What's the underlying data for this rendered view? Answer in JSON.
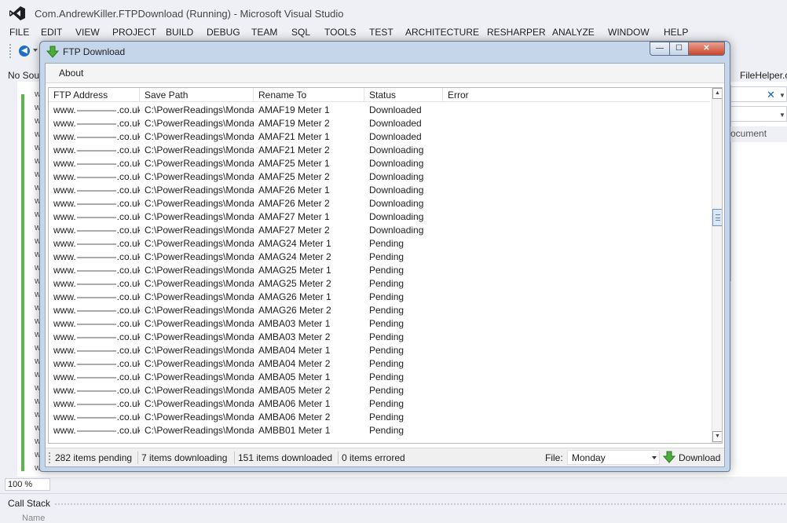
{
  "vs": {
    "title": "Com.AndrewKiller.FTPDownload (Running) - Microsoft Visual Studio",
    "menu": [
      "FILE",
      "EDIT",
      "VIEW",
      "PROJECT",
      "BUILD",
      "DEBUG",
      "TEAM",
      "SQL",
      "TOOLS",
      "TEST",
      "ARCHITECTURE",
      "RESHARPER",
      "ANALYZE",
      "WINDOW",
      "HELP"
    ],
    "no_source_tab": "No Sou",
    "filehelper_tab": "FileHelper.c",
    "right_panel_header": "ocument",
    "zoom": "100 %",
    "call_stack": "Call Stack",
    "call_stack_column": "Name",
    "accent": "#57b94a"
  },
  "ftp": {
    "title": "FTP Download",
    "controls": {
      "minimize": "—",
      "maximize": "☐",
      "close": "✕"
    },
    "menu_about": "About",
    "columns": [
      "FTP Address",
      "Save Path",
      "Rename To",
      "Status",
      "Error"
    ],
    "rows": [
      [
        "www.",
        "co.uk",
        "C:\\PowerReadings\\Monday",
        "AMAF19 Meter 1",
        "Downloaded",
        ""
      ],
      [
        "www.",
        "co.uk",
        "C:\\PowerReadings\\Monday",
        "AMAF19 Meter 2",
        "Downloaded",
        ""
      ],
      [
        "www.",
        "co.uk",
        "C:\\PowerReadings\\Monday",
        "AMAF21 Meter 1",
        "Downloaded",
        ""
      ],
      [
        "www.",
        "co.uk",
        "C:\\PowerReadings\\Monday",
        "AMAF21 Meter 2",
        "Downloading",
        ""
      ],
      [
        "www.",
        "co.uk",
        "C:\\PowerReadings\\Monday",
        "AMAF25 Meter 1",
        "Downloading",
        ""
      ],
      [
        "www.",
        "co.uk",
        "C:\\PowerReadings\\Monday",
        "AMAF25 Meter 2",
        "Downloading",
        ""
      ],
      [
        "www.",
        "co.uk",
        "C:\\PowerReadings\\Monday",
        "AMAF26 Meter 1",
        "Downloading",
        ""
      ],
      [
        "www.",
        "co.uk",
        "C:\\PowerReadings\\Monday",
        "AMAF26 Meter 2",
        "Downloading",
        ""
      ],
      [
        "www.",
        "co.uk",
        "C:\\PowerReadings\\Monday",
        "AMAF27 Meter 1",
        "Downloading",
        ""
      ],
      [
        "www.",
        "co.uk",
        "C:\\PowerReadings\\Monday",
        "AMAF27 Meter 2",
        "Downloading",
        ""
      ],
      [
        "www.",
        "co.uk",
        "C:\\PowerReadings\\Monday",
        "AMAG24 Meter 1",
        "Pending",
        ""
      ],
      [
        "www.",
        "co.uk",
        "C:\\PowerReadings\\Monday",
        "AMAG24 Meter 2",
        "Pending",
        ""
      ],
      [
        "www.",
        "co.uk",
        "C:\\PowerReadings\\Monday",
        "AMAG25 Meter 1",
        "Pending",
        ""
      ],
      [
        "www.",
        "co.uk",
        "C:\\PowerReadings\\Monday",
        "AMAG25 Meter 2",
        "Pending",
        ""
      ],
      [
        "www.",
        "co.uk",
        "C:\\PowerReadings\\Monday",
        "AMAG26 Meter 1",
        "Pending",
        ""
      ],
      [
        "www.",
        "co.uk",
        "C:\\PowerReadings\\Monday",
        "AMAG26 Meter 2",
        "Pending",
        ""
      ],
      [
        "www.",
        "co.uk",
        "C:\\PowerReadings\\Monday",
        "AMBA03 Meter 1",
        "Pending",
        ""
      ],
      [
        "www.",
        "co.uk",
        "C:\\PowerReadings\\Monday",
        "AMBA03 Meter 2",
        "Pending",
        ""
      ],
      [
        "www.",
        "co.uk",
        "C:\\PowerReadings\\Monday",
        "AMBA04 Meter 1",
        "Pending",
        ""
      ],
      [
        "www.",
        "co.uk",
        "C:\\PowerReadings\\Monday",
        "AMBA04 Meter 2",
        "Pending",
        ""
      ],
      [
        "www.",
        "co.uk",
        "C:\\PowerReadings\\Monday",
        "AMBA05 Meter 1",
        "Pending",
        ""
      ],
      [
        "www.",
        "co.uk",
        "C:\\PowerReadings\\Monday",
        "AMBA05 Meter 2",
        "Pending",
        ""
      ],
      [
        "www.",
        "co.uk",
        "C:\\PowerReadings\\Monday",
        "AMBA06 Meter 1",
        "Pending",
        ""
      ],
      [
        "www.",
        "co.uk",
        "C:\\PowerReadings\\Monday",
        "AMBA06 Meter 2",
        "Pending",
        ""
      ],
      [
        "www.",
        "co.uk",
        "C:\\PowerReadings\\Monday",
        "AMBB01 Meter 1",
        "Pending",
        ""
      ]
    ],
    "status": {
      "pending": "282 items pending",
      "downloading": "7 items downloading",
      "downloaded": "151 items downloaded",
      "errored": "0 items errored"
    },
    "file_label": "File:",
    "file_value": "Monday",
    "download_label": "Download",
    "icons": {
      "app": "green-down-arrow-icon",
      "download": "green-down-arrow-icon"
    }
  }
}
